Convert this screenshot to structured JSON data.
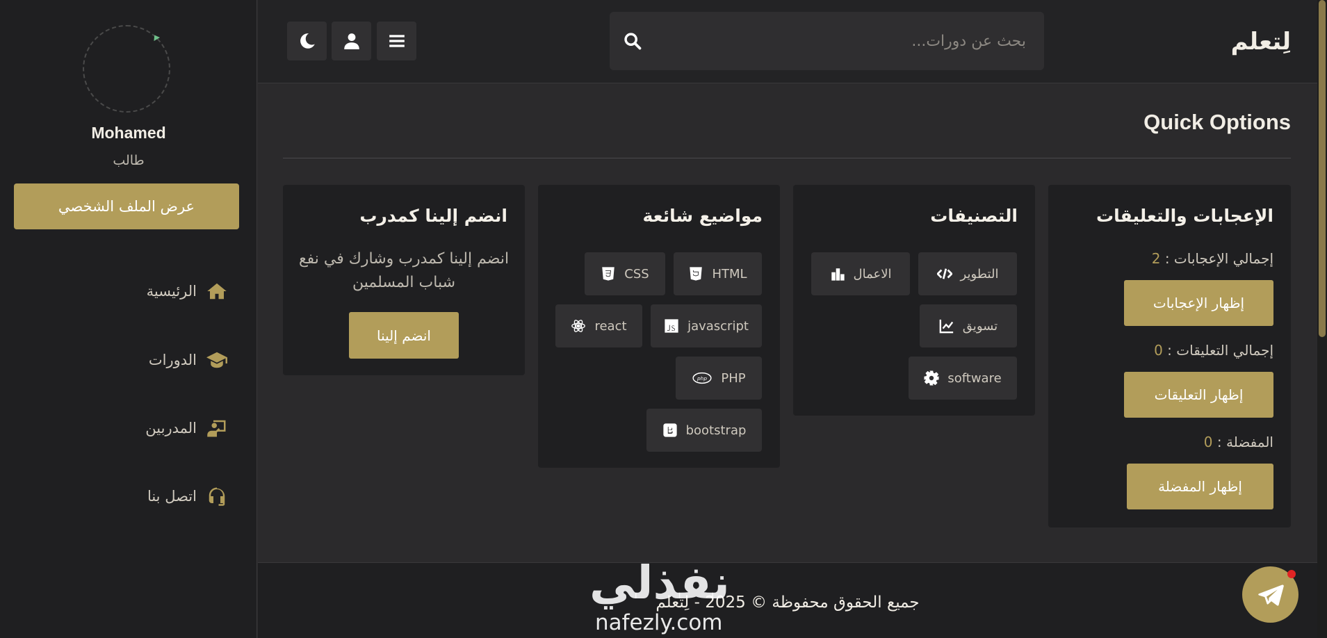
{
  "sidebar": {
    "username": "Mohamed",
    "role": "طالب",
    "profile_button": "عرض الملف الشخصي",
    "nav": [
      {
        "label": "الرئيسية",
        "icon": "home-icon"
      },
      {
        "label": "الدورات",
        "icon": "graduation-cap-icon"
      },
      {
        "label": "المدربين",
        "icon": "chalkboard-teacher-icon"
      },
      {
        "label": "اتصل بنا",
        "icon": "headset-icon"
      }
    ]
  },
  "header": {
    "brand": "لِتعلم",
    "search_placeholder": "بحث عن دورات...",
    "buttons": [
      "menu-icon",
      "user-icon",
      "moon-icon"
    ]
  },
  "main": {
    "title": "Quick Options",
    "likes_card": {
      "title": "الإعجابات والتعليقات",
      "likes_label": "إجمالي الإعجابات :",
      "likes_value": "2",
      "likes_button": "إظهار الإعجابات",
      "comments_label": "إجمالي التعليقات :",
      "comments_value": "0",
      "comments_button": "إظهار التعليقات",
      "favorites_label": "المفضلة :",
      "favorites_value": "0",
      "favorites_button": "إظهار المفضلة"
    },
    "categories_card": {
      "title": "التصنيفات",
      "items": [
        {
          "label": "التطوير",
          "icon": "code-icon"
        },
        {
          "label": "الاعمال",
          "icon": "bar-chart-icon"
        },
        {
          "label": "تسويق",
          "icon": "line-chart-icon"
        },
        {
          "label": "software",
          "icon": "gear-icon"
        }
      ]
    },
    "topics_card": {
      "title": "مواضيع شائعة",
      "items": [
        {
          "label": "HTML",
          "icon": "html5-icon"
        },
        {
          "label": "CSS",
          "icon": "css3-icon"
        },
        {
          "label": "javascript",
          "icon": "js-icon"
        },
        {
          "label": "react",
          "icon": "react-icon"
        },
        {
          "label": "PHP",
          "icon": "php-icon"
        },
        {
          "label": "bootstrap",
          "icon": "bootstrap-icon"
        }
      ]
    },
    "join_card": {
      "title": "انضم إلينا كمدرب",
      "text": "انضم إلينا كمدرب وشارك في نفع شباب المسلمين",
      "button": "انضم إلينا"
    }
  },
  "footer": {
    "text": "جميع الحقوق محفوظة © 2025 - لِتعلم"
  },
  "watermark": {
    "arabic": "نفذلي",
    "latin": "nafezly.com"
  },
  "colors": {
    "accent": "#b29d5a",
    "background": "#2b2a2c",
    "card": "#1f1f21",
    "notification": "#e02424"
  }
}
